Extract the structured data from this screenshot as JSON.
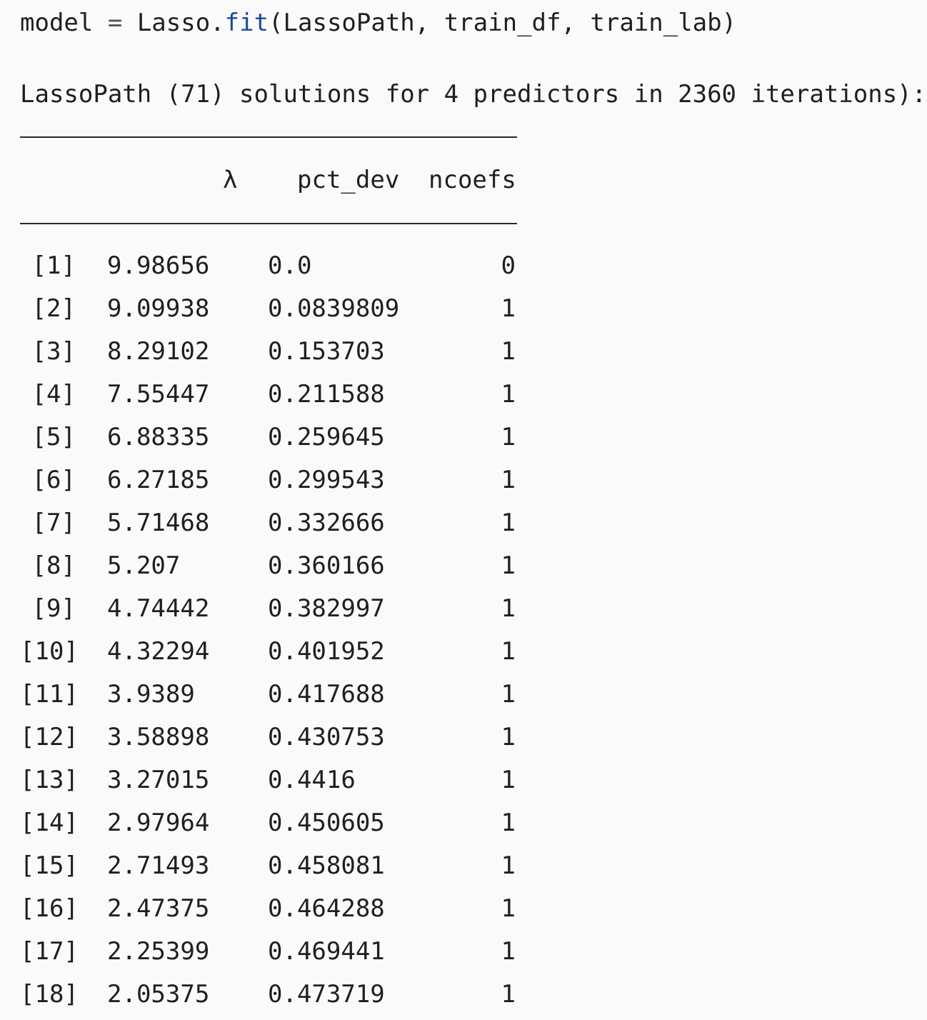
{
  "code": {
    "lhs": "model",
    "eq": "=",
    "obj": "Lasso.",
    "func": "fit",
    "args": "(LassoPath, train_df, train_lab)"
  },
  "output": {
    "header": "LassoPath (71) solutions for 4 predictors in 2360 iterations):",
    "columns": {
      "lambda": "λ",
      "pct_dev": "pct_dev",
      "ncoefs": "ncoefs"
    },
    "rows": [
      {
        "idx": "[1]",
        "lambda": "9.98656",
        "pct_dev": "0.0",
        "ncoefs": "0"
      },
      {
        "idx": "[2]",
        "lambda": "9.09938",
        "pct_dev": "0.0839809",
        "ncoefs": "1"
      },
      {
        "idx": "[3]",
        "lambda": "8.29102",
        "pct_dev": "0.153703",
        "ncoefs": "1"
      },
      {
        "idx": "[4]",
        "lambda": "7.55447",
        "pct_dev": "0.211588",
        "ncoefs": "1"
      },
      {
        "idx": "[5]",
        "lambda": "6.88335",
        "pct_dev": "0.259645",
        "ncoefs": "1"
      },
      {
        "idx": "[6]",
        "lambda": "6.27185",
        "pct_dev": "0.299543",
        "ncoefs": "1"
      },
      {
        "idx": "[7]",
        "lambda": "5.71468",
        "pct_dev": "0.332666",
        "ncoefs": "1"
      },
      {
        "idx": "[8]",
        "lambda": "5.207",
        "pct_dev": "0.360166",
        "ncoefs": "1"
      },
      {
        "idx": "[9]",
        "lambda": "4.74442",
        "pct_dev": "0.382997",
        "ncoefs": "1"
      },
      {
        "idx": "[10]",
        "lambda": "4.32294",
        "pct_dev": "0.401952",
        "ncoefs": "1"
      },
      {
        "idx": "[11]",
        "lambda": "3.9389",
        "pct_dev": "0.417688",
        "ncoefs": "1"
      },
      {
        "idx": "[12]",
        "lambda": "3.58898",
        "pct_dev": "0.430753",
        "ncoefs": "1"
      },
      {
        "idx": "[13]",
        "lambda": "3.27015",
        "pct_dev": "0.4416",
        "ncoefs": "1"
      },
      {
        "idx": "[14]",
        "lambda": "2.97964",
        "pct_dev": "0.450605",
        "ncoefs": "1"
      },
      {
        "idx": "[15]",
        "lambda": "2.71493",
        "pct_dev": "0.458081",
        "ncoefs": "1"
      },
      {
        "idx": "[16]",
        "lambda": "2.47375",
        "pct_dev": "0.464288",
        "ncoefs": "1"
      },
      {
        "idx": "[17]",
        "lambda": "2.25399",
        "pct_dev": "0.469441",
        "ncoefs": "1"
      },
      {
        "idx": "[18]",
        "lambda": "2.05375",
        "pct_dev": "0.473719",
        "ncoefs": "1"
      }
    ]
  },
  "colors": {
    "background": "#fafafa",
    "text": "#1f1f1f",
    "function_name": "#1a4a9c"
  }
}
